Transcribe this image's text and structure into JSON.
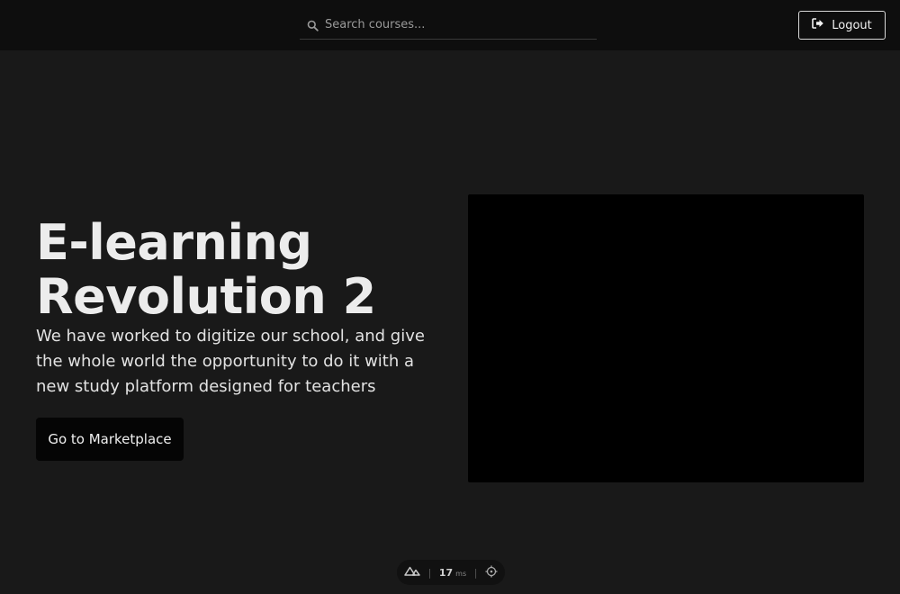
{
  "header": {
    "search": {
      "placeholder": "Search courses...",
      "icon": "search-icon"
    },
    "logout_label": "Logout",
    "logout_icon": "logout-icon"
  },
  "hero": {
    "title_line1": "E-learning",
    "title_line2": "Revolution 2",
    "description": "We have worked to digitize our school, and give the whole world the opportunity to do it with a new study platform designed for teachers",
    "cta_label": "Go to Marketplace"
  },
  "devtools": {
    "render_time": "17",
    "unit": "ms",
    "logo_icon": "nuxt-icon",
    "inspect_icon": "crosshair-icon"
  },
  "colors": {
    "page_bg": "#191919",
    "header_bg": "#0e0e0e",
    "media_bg": "#000000",
    "button_bg": "#050505"
  }
}
